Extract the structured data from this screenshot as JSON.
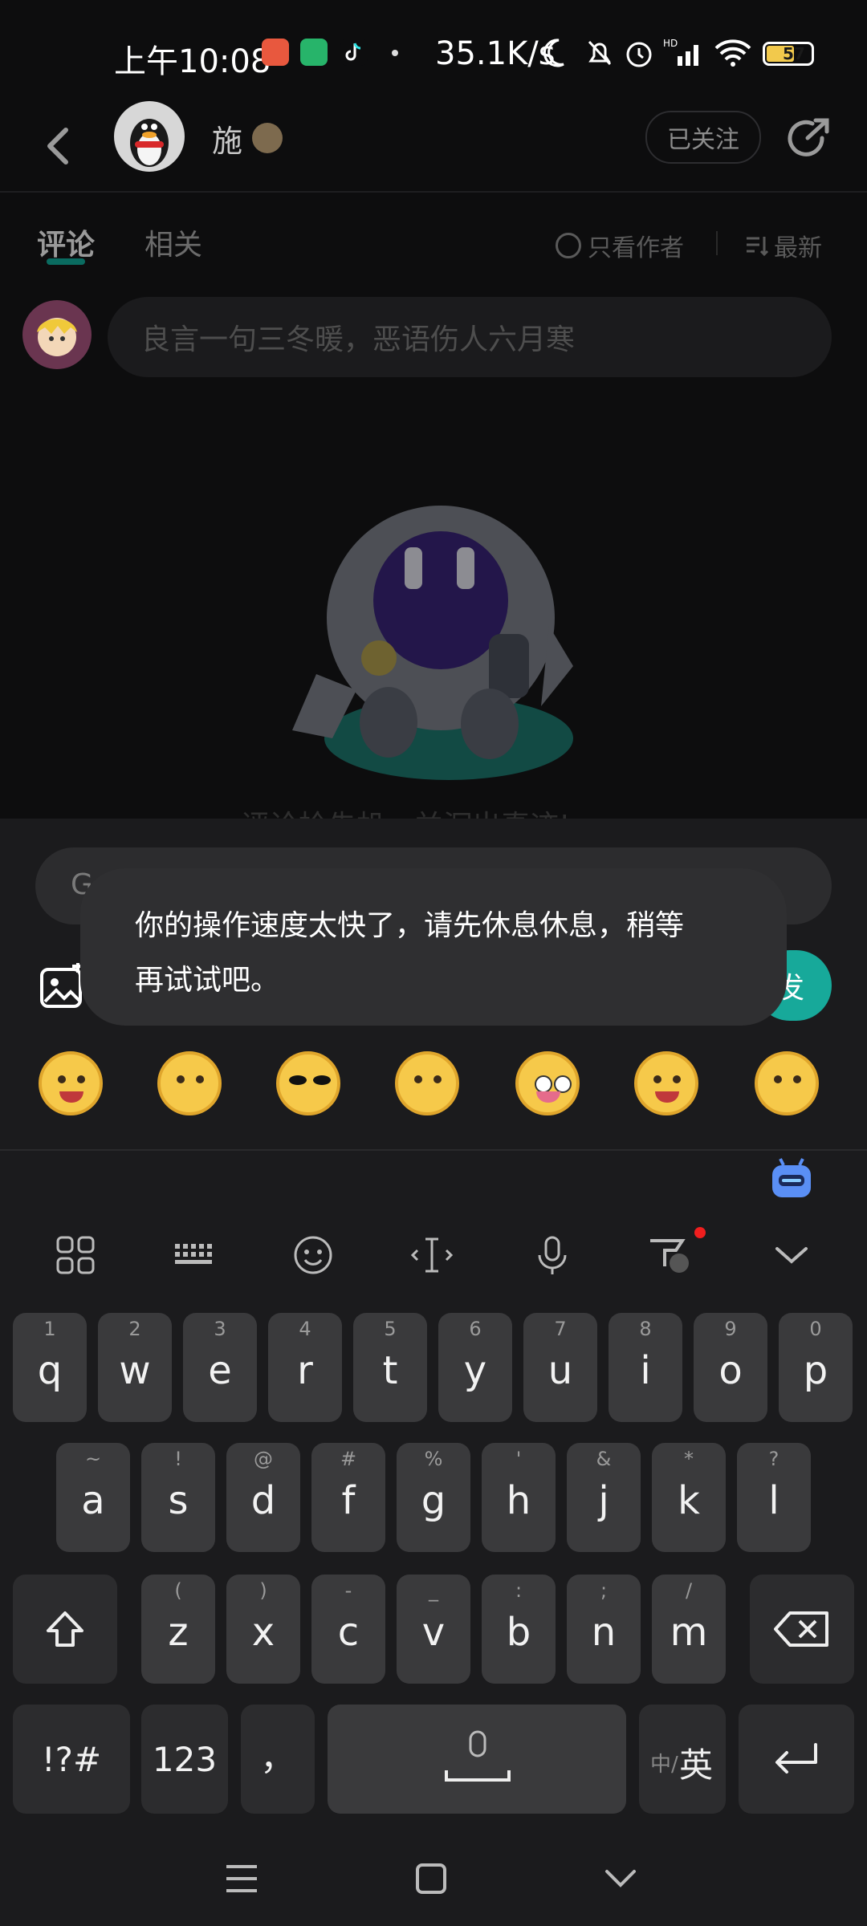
{
  "status_bar": {
    "time": "上午10:08",
    "net_speed": "35.1K/s",
    "battery": "57"
  },
  "header": {
    "username": "施",
    "follow_label": "已关注"
  },
  "tabs": {
    "comments": "评论",
    "related": "相关",
    "only_author": "只看作者",
    "sort": "最新"
  },
  "comment_input": {
    "placeholder": "良言一句三冬暖，恶语伤人六月寒"
  },
  "empty_state": {
    "text": "评论抢先机，并沉出真迹!"
  },
  "composer": {
    "input_text": "Go",
    "send_label": "发"
  },
  "toast": {
    "line1": "你的操作速度太快了，请先休息休息，稍等",
    "line2": "再试试吧。"
  },
  "keyboard": {
    "row1": [
      {
        "hint": "1",
        "ch": "q"
      },
      {
        "hint": "2",
        "ch": "w"
      },
      {
        "hint": "3",
        "ch": "e"
      },
      {
        "hint": "4",
        "ch": "r"
      },
      {
        "hint": "5",
        "ch": "t"
      },
      {
        "hint": "6",
        "ch": "y"
      },
      {
        "hint": "7",
        "ch": "u"
      },
      {
        "hint": "8",
        "ch": "i"
      },
      {
        "hint": "9",
        "ch": "o"
      },
      {
        "hint": "0",
        "ch": "p"
      }
    ],
    "row2": [
      {
        "hint": "~",
        "ch": "a"
      },
      {
        "hint": "!",
        "ch": "s"
      },
      {
        "hint": "@",
        "ch": "d"
      },
      {
        "hint": "#",
        "ch": "f"
      },
      {
        "hint": "%",
        "ch": "g"
      },
      {
        "hint": "'",
        "ch": "h"
      },
      {
        "hint": "&",
        "ch": "j"
      },
      {
        "hint": "*",
        "ch": "k"
      },
      {
        "hint": "?",
        "ch": "l"
      }
    ],
    "row3": [
      {
        "hint": "(",
        "ch": "z"
      },
      {
        "hint": ")",
        "ch": "x"
      },
      {
        "hint": "-",
        "ch": "c"
      },
      {
        "hint": "_",
        "ch": "v"
      },
      {
        "hint": ":",
        "ch": "b"
      },
      {
        "hint": ";",
        "ch": "n"
      },
      {
        "hint": "/",
        "ch": "m"
      }
    ],
    "symbols": "!?#",
    "numbers": "123",
    "punct": "，",
    "lang_small": "中/",
    "lang_big": "英"
  },
  "colors": {
    "accent": "#17a99a",
    "background": "#0d0d0e",
    "panel": "#1b1b1d",
    "key": "#3a3a3c"
  }
}
